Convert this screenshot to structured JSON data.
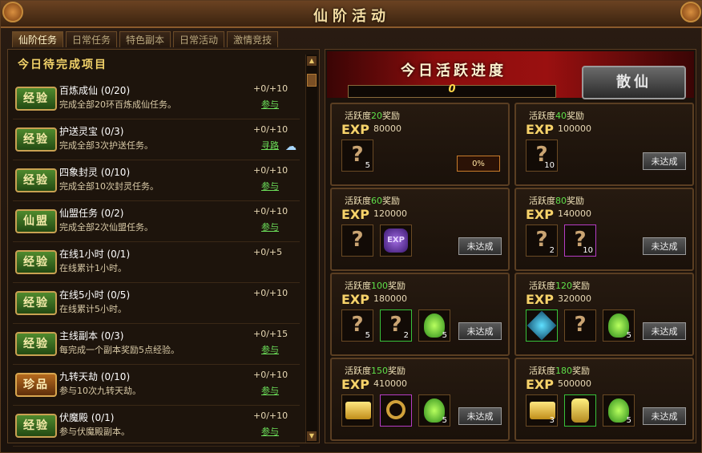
{
  "window": {
    "title": "仙阶活动"
  },
  "tabs": [
    {
      "label": "仙阶任务",
      "active": true
    },
    {
      "label": "日常任务",
      "active": false
    },
    {
      "label": "特色副本",
      "active": false
    },
    {
      "label": "日常活动",
      "active": false
    },
    {
      "label": "激情竞技",
      "active": false
    }
  ],
  "task_panel": {
    "header": "今日待完成项目",
    "tasks": [
      {
        "badge": "经验",
        "badge_color": "#4f8a2e",
        "name": "百炼成仙 (0/20)",
        "desc": "完成全部20环百炼成仙任务。",
        "score": "+0/+10",
        "action": "参与"
      },
      {
        "badge": "经验",
        "badge_color": "#4f8a2e",
        "name": "护送灵宝 (0/3)",
        "desc": "完成全部3次护送任务。",
        "score": "+0/+10",
        "action": "寻路"
      },
      {
        "badge": "经验",
        "badge_color": "#4f8a2e",
        "name": "四象封灵 (0/10)",
        "desc": "完成全部10次封灵任务。",
        "score": "+0/+10",
        "action": "参与"
      },
      {
        "badge": "仙盟",
        "badge_color": "#4f8a2e",
        "name": "仙盟任务 (0/2)",
        "desc": "完成全部2次仙盟任务。",
        "score": "+0/+10",
        "action": "参与"
      },
      {
        "badge": "经验",
        "badge_color": "#4f8a2e",
        "name": "在线1小时 (0/1)",
        "desc": "在线累计1小时。",
        "score": "+0/+5",
        "action": ""
      },
      {
        "badge": "经验",
        "badge_color": "#4f8a2e",
        "name": "在线5小时 (0/5)",
        "desc": "在线累计5小时。",
        "score": "+0/+10",
        "action": ""
      },
      {
        "badge": "经验",
        "badge_color": "#4f8a2e",
        "name": "主线副本 (0/3)",
        "desc": "每完成一个副本奖励5点经验。",
        "score": "+0/+15",
        "action": "参与"
      },
      {
        "badge": "珍品",
        "badge_color": "#b56a1e",
        "name": "九转天劫 (0/10)",
        "desc": "参与10次九转天劫。",
        "score": "+0/+10",
        "action": "参与"
      },
      {
        "badge": "经验",
        "badge_color": "#4f8a2e",
        "name": "伏魔殿 (0/1)",
        "desc": "参与伏魔殿副本。",
        "score": "+0/+10",
        "action": "参与"
      }
    ]
  },
  "activity": {
    "title": "今日活跃进度",
    "progress_value": "0",
    "progress_fraction": 0,
    "sanxian_label": "散仙"
  },
  "rewards": [
    {
      "prefix": "活跃度",
      "level": "20",
      "suffix": "奖励",
      "exp_label": "EXP",
      "exp": "80000",
      "items": [
        {
          "kind": "question",
          "count": "5",
          "frame": ""
        }
      ],
      "status": "0%",
      "status_type": "percent"
    },
    {
      "prefix": "活跃度",
      "level": "40",
      "suffix": "奖励",
      "exp_label": "EXP",
      "exp": "100000",
      "items": [
        {
          "kind": "question",
          "count": "10",
          "frame": ""
        }
      ],
      "status": "未达成",
      "status_type": "button"
    },
    {
      "prefix": "活跃度",
      "level": "60",
      "suffix": "奖励",
      "exp_label": "EXP",
      "exp": "120000",
      "items": [
        {
          "kind": "question",
          "count": "",
          "frame": ""
        },
        {
          "kind": "exp-bag",
          "count": "",
          "frame": "",
          "text": "EXP"
        }
      ],
      "status": "未达成",
      "status_type": "button"
    },
    {
      "prefix": "活跃度",
      "level": "80",
      "suffix": "奖励",
      "exp_label": "EXP",
      "exp": "140000",
      "items": [
        {
          "kind": "question",
          "count": "2",
          "frame": ""
        },
        {
          "kind": "question",
          "count": "10",
          "frame": "purple"
        }
      ],
      "status": "未达成",
      "status_type": "button"
    },
    {
      "prefix": "活跃度",
      "level": "100",
      "suffix": "奖励",
      "exp_label": "EXP",
      "exp": "180000",
      "items": [
        {
          "kind": "question",
          "count": "5",
          "frame": ""
        },
        {
          "kind": "question",
          "count": "2",
          "frame": "green"
        },
        {
          "kind": "potion",
          "count": "5",
          "frame": ""
        }
      ],
      "status": "未达成",
      "status_type": "button"
    },
    {
      "prefix": "活跃度",
      "level": "120",
      "suffix": "奖励",
      "exp_label": "EXP",
      "exp": "320000",
      "items": [
        {
          "kind": "gem",
          "count": "",
          "frame": "green"
        },
        {
          "kind": "question",
          "count": "",
          "frame": ""
        },
        {
          "kind": "potion",
          "count": "5",
          "frame": ""
        }
      ],
      "status": "未达成",
      "status_type": "button"
    },
    {
      "prefix": "活跃度",
      "level": "150",
      "suffix": "奖励",
      "exp_label": "EXP",
      "exp": "410000",
      "items": [
        {
          "kind": "gold",
          "count": "",
          "frame": ""
        },
        {
          "kind": "ring",
          "count": "",
          "frame": "purple"
        },
        {
          "kind": "potion",
          "count": "5",
          "frame": ""
        }
      ],
      "status": "未达成",
      "status_type": "button"
    },
    {
      "prefix": "活跃度",
      "level": "180",
      "suffix": "奖励",
      "exp_label": "EXP",
      "exp": "500000",
      "items": [
        {
          "kind": "gold",
          "count": "3",
          "frame": ""
        },
        {
          "kind": "key",
          "count": "",
          "frame": "green"
        },
        {
          "kind": "potion",
          "count": "5",
          "frame": ""
        }
      ],
      "status": "未达成",
      "status_type": "button"
    }
  ]
}
